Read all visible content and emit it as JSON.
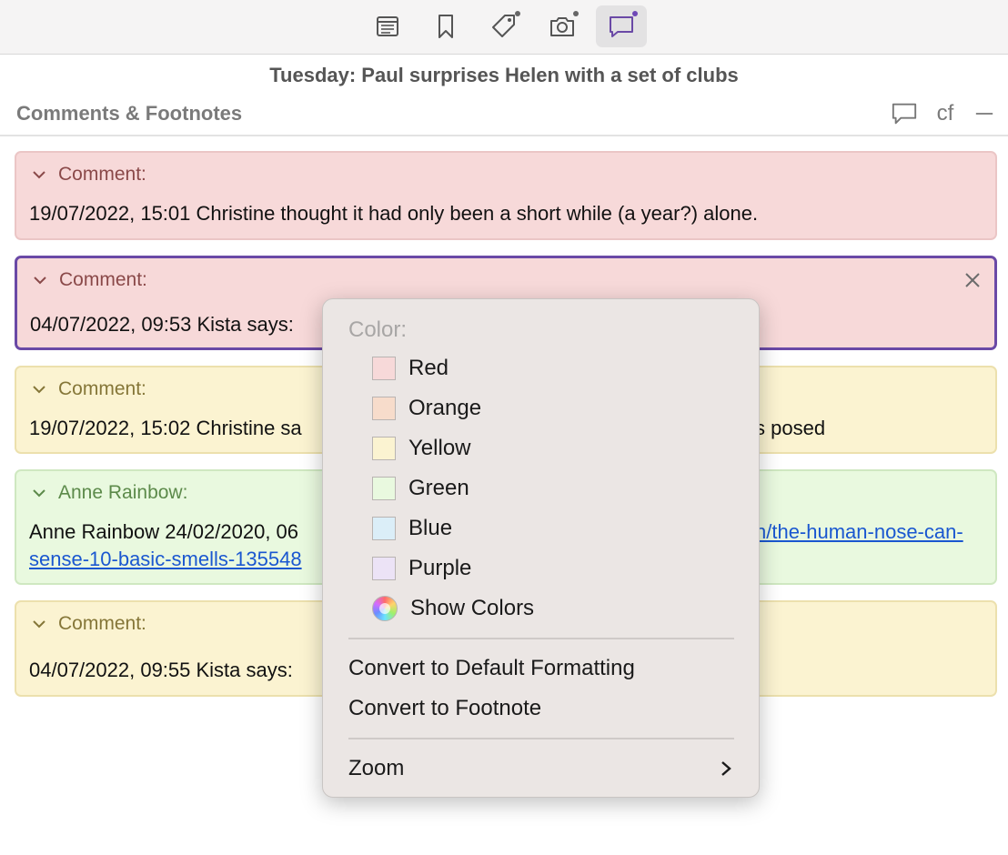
{
  "toolbar": {
    "buttons": [
      {
        "name": "synopsis",
        "icon": "synopsis-icon",
        "active": false,
        "dot": false
      },
      {
        "name": "bookmarks",
        "icon": "bookmark-icon",
        "active": false,
        "dot": false
      },
      {
        "name": "metadata",
        "icon": "tag-icon",
        "active": false,
        "dot": true
      },
      {
        "name": "snapshots",
        "icon": "camera-icon",
        "active": false,
        "dot": true
      },
      {
        "name": "comments",
        "icon": "comment-icon",
        "active": true,
        "dot": true
      }
    ]
  },
  "document": {
    "title": "Tuesday: Paul surprises Helen with a set of clubs"
  },
  "section": {
    "title": "Comments & Footnotes",
    "cf_label": "cf"
  },
  "comments": [
    {
      "header": "Comment:",
      "text": "19/07/2022, 15:01 Christine thought it had only been a short while (a year?) alone.",
      "color": "#f7d9d9"
    },
    {
      "header": "Comment:",
      "text": "04/07/2022, 09:53 Kista says:",
      "color": "#f7d9d9",
      "selected": true
    },
    {
      "header": "Comment:",
      "text_left": "19/07/2022, 15:02 Christine sa",
      "text_right": "s posed",
      "color": "#fbf3d1"
    },
    {
      "header": "Anne Rainbow:",
      "text_left": "Anne Rainbow 24/02/2020, 06",
      "link_right": "n/the-human-nose-can-",
      "link_line2": "sense-10-basic-smells-135548",
      "color": "#e9f9df"
    },
    {
      "header": "Comment:",
      "text": "04/07/2022, 09:55 Kista says:",
      "color": "#fbf3d1"
    }
  ],
  "menu": {
    "color_heading": "Color:",
    "colors": [
      {
        "label": "Red",
        "swatch": "#f7d9d9"
      },
      {
        "label": "Orange",
        "swatch": "#f7dccb"
      },
      {
        "label": "Yellow",
        "swatch": "#fbf3d1"
      },
      {
        "label": "Green",
        "swatch": "#e9f9df"
      },
      {
        "label": "Blue",
        "swatch": "#dbeef8"
      },
      {
        "label": "Purple",
        "swatch": "#ece3f6"
      }
    ],
    "show_colors": "Show Colors",
    "convert_default": "Convert to Default Formatting",
    "convert_footnote": "Convert to Footnote",
    "zoom": "Zoom"
  },
  "colors": {
    "accent": "#6a49a6",
    "link": "#1a57d0"
  }
}
